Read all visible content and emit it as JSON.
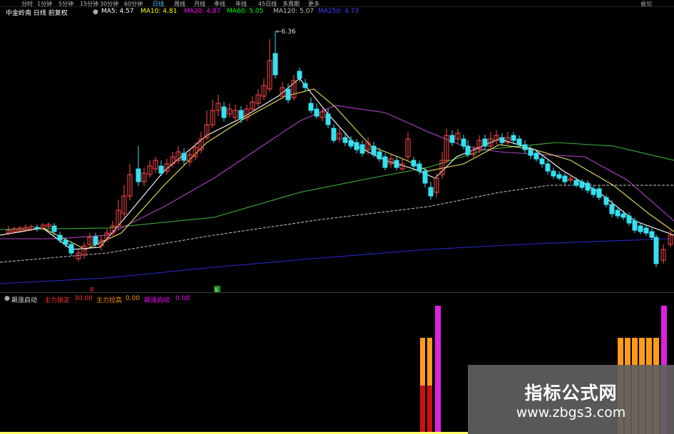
{
  "toolbar": {
    "periods": [
      "分时",
      "1分钟",
      "5分钟",
      "15分钟",
      "30分钟",
      "60分钟",
      "日线",
      "周线",
      "月线",
      "季线",
      "年线",
      "45日线",
      "多周期",
      "更多"
    ],
    "active_period": "日线",
    "right_label": "叠加"
  },
  "header": {
    "title": "中金岭南 日线 前复权",
    "indicators": [
      {
        "label": "MA5: 4.57",
        "color": "#ffffff"
      },
      {
        "label": "MA10: 4.81",
        "color": "#ffff00"
      },
      {
        "label": "MA20: 4.87",
        "color": "#ff00ff"
      },
      {
        "label": "MA60: 5.05",
        "color": "#00ff00"
      },
      {
        "label": "MA120: 5.07",
        "color": "#c0c0c0"
      },
      {
        "label": "MA250: 4.73",
        "color": "#4040ff"
      }
    ]
  },
  "annotations": {
    "high_price": "6.36",
    "marker_red": "B",
    "marker_green": "S"
  },
  "sub_indicator": {
    "name": "飙涨启动",
    "items": [
      {
        "label": "主力锁定",
        "color": "#ff3030"
      },
      {
        "label": "30.00",
        "color": "#ff3030"
      },
      {
        "label": "主力拉高",
        "color": "#ff9900"
      },
      {
        "label": "0.00",
        "color": "#ff9900"
      },
      {
        "label": "飙涨启动",
        "color": "#ff00ff"
      },
      {
        "label": "0.00",
        "color": "#ff00ff"
      }
    ]
  },
  "watermark": {
    "title": "指标公式网",
    "url": "www.zbgs3.com"
  },
  "colors": {
    "up": "#ff4a4a",
    "down": "#36e0f0",
    "ma5": "#ffffff",
    "ma10": "#e6e65a",
    "ma20": "#b040c8",
    "ma60": "#3cb43c",
    "ma120": "#c8c8c8",
    "ma250": "#2828c8"
  }
}
